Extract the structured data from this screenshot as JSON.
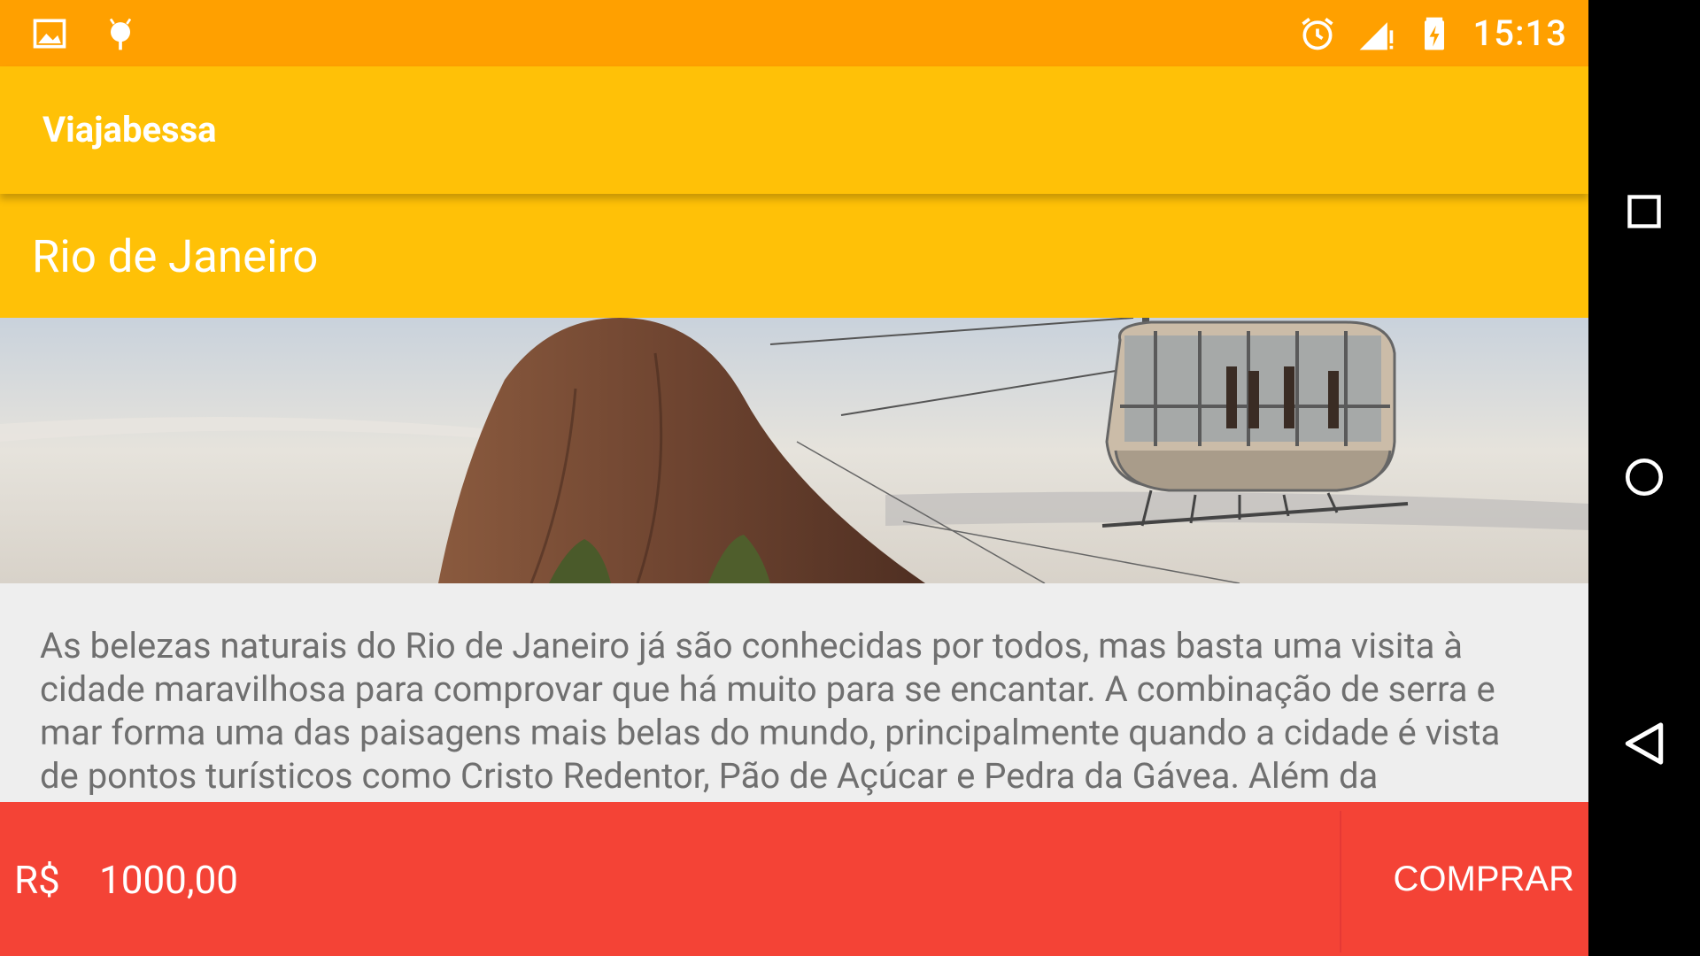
{
  "status_bar": {
    "time": "15:13",
    "left_icons": [
      "image-notification-icon",
      "android-notification-icon"
    ],
    "right_icons": [
      "alarm-icon",
      "signal-icon",
      "battery-charging-icon"
    ]
  },
  "app_bar": {
    "title": "Viajabessa"
  },
  "destination": {
    "title": "Rio de Janeiro"
  },
  "description": "As belezas naturais do Rio de Janeiro já são conhecidas por todos, mas basta uma visita à cidade maravilhosa para comprovar que há muito para se encantar. A combinação de serra e mar forma uma das paisagens mais belas do mundo, principalmente quando a cidade é vista de pontos turísticos como Cristo Redentor, Pão de Açúcar e Pedra da Gávea. Além da",
  "bottom_bar": {
    "currency": "R$",
    "price": "1000,00",
    "buy_label": "COMPRAR"
  },
  "colors": {
    "status_bar": "#ffa000",
    "app_bar": "#ffc107",
    "bottom_bar": "#f44336",
    "background": "#eeeeee"
  },
  "nav_bar": {
    "buttons": [
      "recents-icon",
      "home-icon",
      "back-icon"
    ]
  }
}
